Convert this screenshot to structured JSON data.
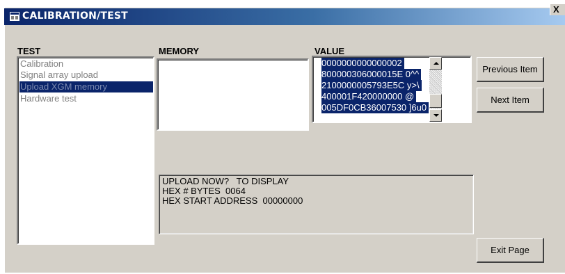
{
  "window": {
    "title": "CALIBRATION/TEST",
    "close_label": "X"
  },
  "test": {
    "label": "TEST",
    "items": [
      "Calibration",
      "Signal array upload",
      "Upload XGM memory",
      "Hardware test"
    ],
    "selected_index": 2
  },
  "memory": {
    "label": "MEMORY"
  },
  "value": {
    "label": "VALUE",
    "lines": [
      "0000000000000002",
      "800000306000015E 0^^",
      "2100000005793E5C y>\\",
      "400001F420000000 @",
      "005DF0CB36007530 ]6u0"
    ]
  },
  "status": {
    "lines": [
      "UPLOAD NOW?   TO DISPLAY",
      "HEX # BYTES  0064",
      "HEX START ADDRESS  00000000"
    ]
  },
  "buttons": {
    "previous": "Previous Item",
    "next": "Next Item",
    "exit": "Exit Page"
  },
  "colors": {
    "title_bar_start": "#0a246a",
    "title_bar_end": "#a6caf0",
    "selection": "#0a246a",
    "face": "#d4d0c8"
  }
}
